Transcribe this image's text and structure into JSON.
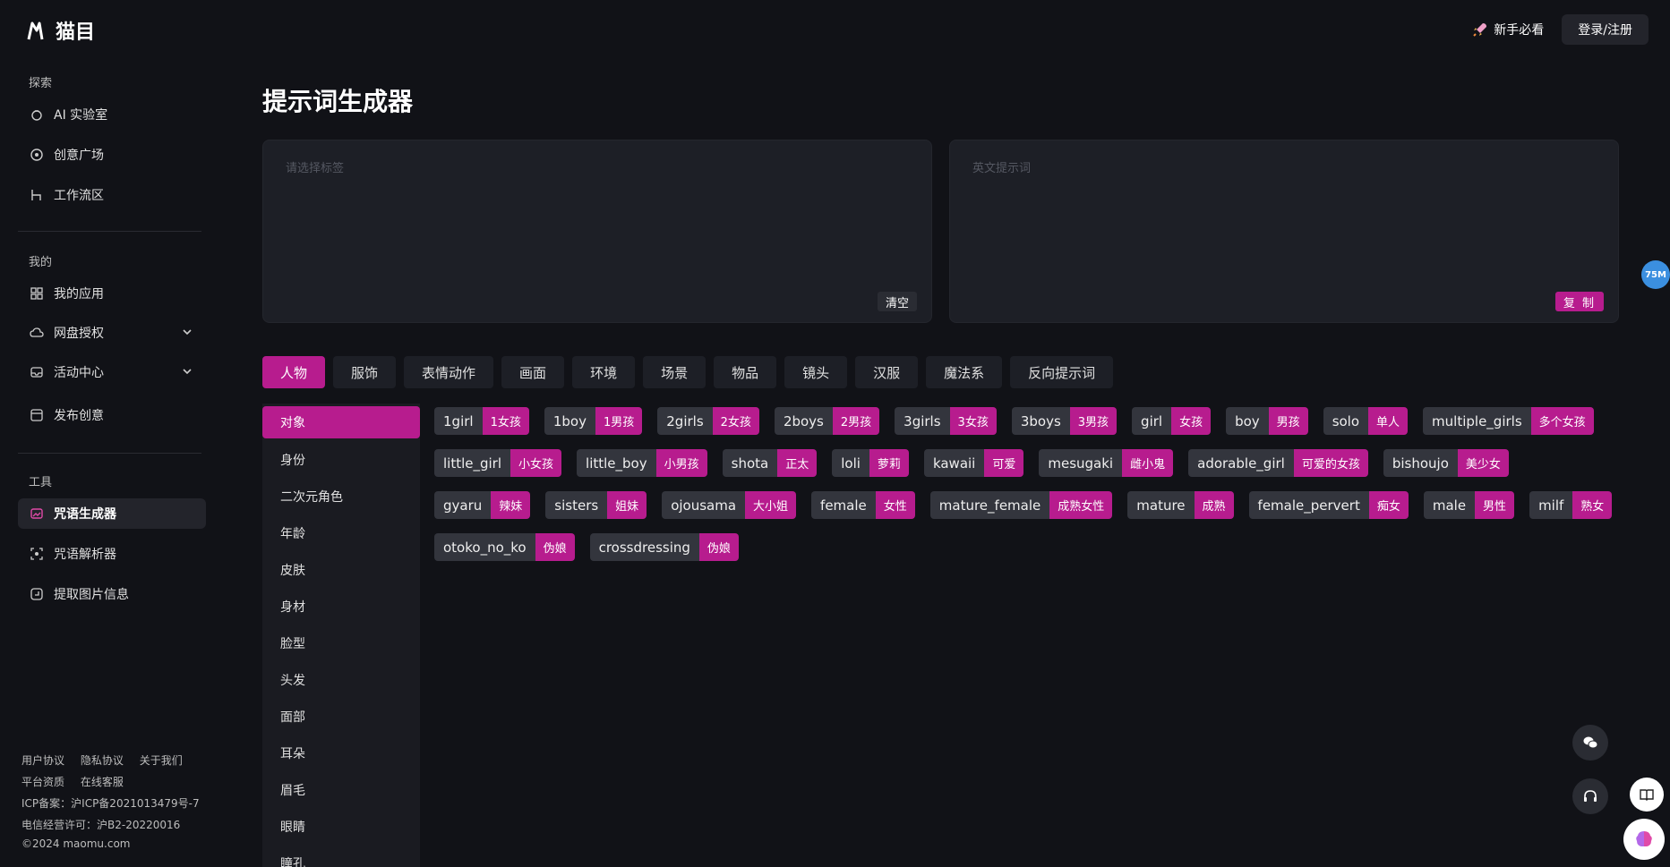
{
  "brand": {
    "name": "猫目"
  },
  "header": {
    "guide_label": "新手必看",
    "login_label": "登录/注册"
  },
  "sidebar": {
    "sections": [
      {
        "title": "探索",
        "items": [
          {
            "label": "AI 实验室",
            "icon": "lab-icon"
          },
          {
            "label": "创意广场",
            "icon": "plaza-icon"
          },
          {
            "label": "工作流区",
            "icon": "workflow-icon"
          }
        ]
      },
      {
        "title": "我的",
        "items": [
          {
            "label": "我的应用",
            "icon": "apps-icon"
          },
          {
            "label": "网盘授权",
            "icon": "cloud-icon"
          },
          {
            "label": "活动中心",
            "icon": "inbox-icon"
          },
          {
            "label": "发布创意",
            "icon": "publish-icon"
          }
        ]
      },
      {
        "title": "工具",
        "items": [
          {
            "label": "咒语生成器",
            "icon": "image-icon"
          },
          {
            "label": "咒语解析器",
            "icon": "scan-icon"
          },
          {
            "label": "提取图片信息",
            "icon": "extract-icon"
          }
        ]
      }
    ],
    "footer": {
      "links": [
        "用户协议",
        "隐私协议",
        "关于我们"
      ],
      "links2": [
        "平台资质",
        "在线客服"
      ],
      "icp": "ICP备案：沪ICP备2021013479号-7",
      "license": "电信经营许可：沪B2-20220016",
      "copyright": "©2024 maomu.com"
    }
  },
  "main": {
    "title": "提示词生成器",
    "left_box": {
      "placeholder": "请选择标签",
      "button": "清空"
    },
    "right_box": {
      "placeholder": "英文提示词",
      "button": "复 制"
    },
    "tabs": [
      "人物",
      "服饰",
      "表情动作",
      "画面",
      "环境",
      "场景",
      "物品",
      "镜头",
      "汉服",
      "魔法系",
      "反向提示词"
    ],
    "categories": [
      "对象",
      "身份",
      "二次元角色",
      "年龄",
      "皮肤",
      "身材",
      "脸型",
      "头发",
      "面部",
      "耳朵",
      "眉毛",
      "眼睛",
      "瞳孔"
    ],
    "tags": [
      {
        "en": "1girl",
        "zh": "1女孩"
      },
      {
        "en": "1boy",
        "zh": "1男孩"
      },
      {
        "en": "2girls",
        "zh": "2女孩"
      },
      {
        "en": "2boys",
        "zh": "2男孩"
      },
      {
        "en": "3girls",
        "zh": "3女孩"
      },
      {
        "en": "3boys",
        "zh": "3男孩"
      },
      {
        "en": "girl",
        "zh": "女孩"
      },
      {
        "en": "boy",
        "zh": "男孩"
      },
      {
        "en": "solo",
        "zh": "单人"
      },
      {
        "en": "multiple_girls",
        "zh": "多个女孩"
      },
      {
        "en": "little_girl",
        "zh": "小女孩"
      },
      {
        "en": "little_boy",
        "zh": "小男孩"
      },
      {
        "en": "shota",
        "zh": "正太"
      },
      {
        "en": "loli",
        "zh": "萝莉"
      },
      {
        "en": "kawaii",
        "zh": "可爱"
      },
      {
        "en": "mesugaki",
        "zh": "雌小鬼"
      },
      {
        "en": "adorable_girl",
        "zh": "可爱的女孩"
      },
      {
        "en": "bishoujo",
        "zh": "美少女"
      },
      {
        "en": "gyaru",
        "zh": "辣妹"
      },
      {
        "en": "sisters",
        "zh": "姐妹"
      },
      {
        "en": "ojousama",
        "zh": "大小姐"
      },
      {
        "en": "female",
        "zh": "女性"
      },
      {
        "en": "mature_female",
        "zh": "成熟女性"
      },
      {
        "en": "mature",
        "zh": "成熟"
      },
      {
        "en": "female_pervert",
        "zh": "痴女"
      },
      {
        "en": "male",
        "zh": "男性"
      },
      {
        "en": "milf",
        "zh": "熟女"
      },
      {
        "en": "otoko_no_ko",
        "zh": "伪娘"
      },
      {
        "en": "crossdressing",
        "zh": "伪娘"
      }
    ]
  },
  "floating": {
    "badge": "75M"
  },
  "colors": {
    "accent": "#b71c8e",
    "bg": "#111217",
    "panel": "#1d1f26"
  }
}
